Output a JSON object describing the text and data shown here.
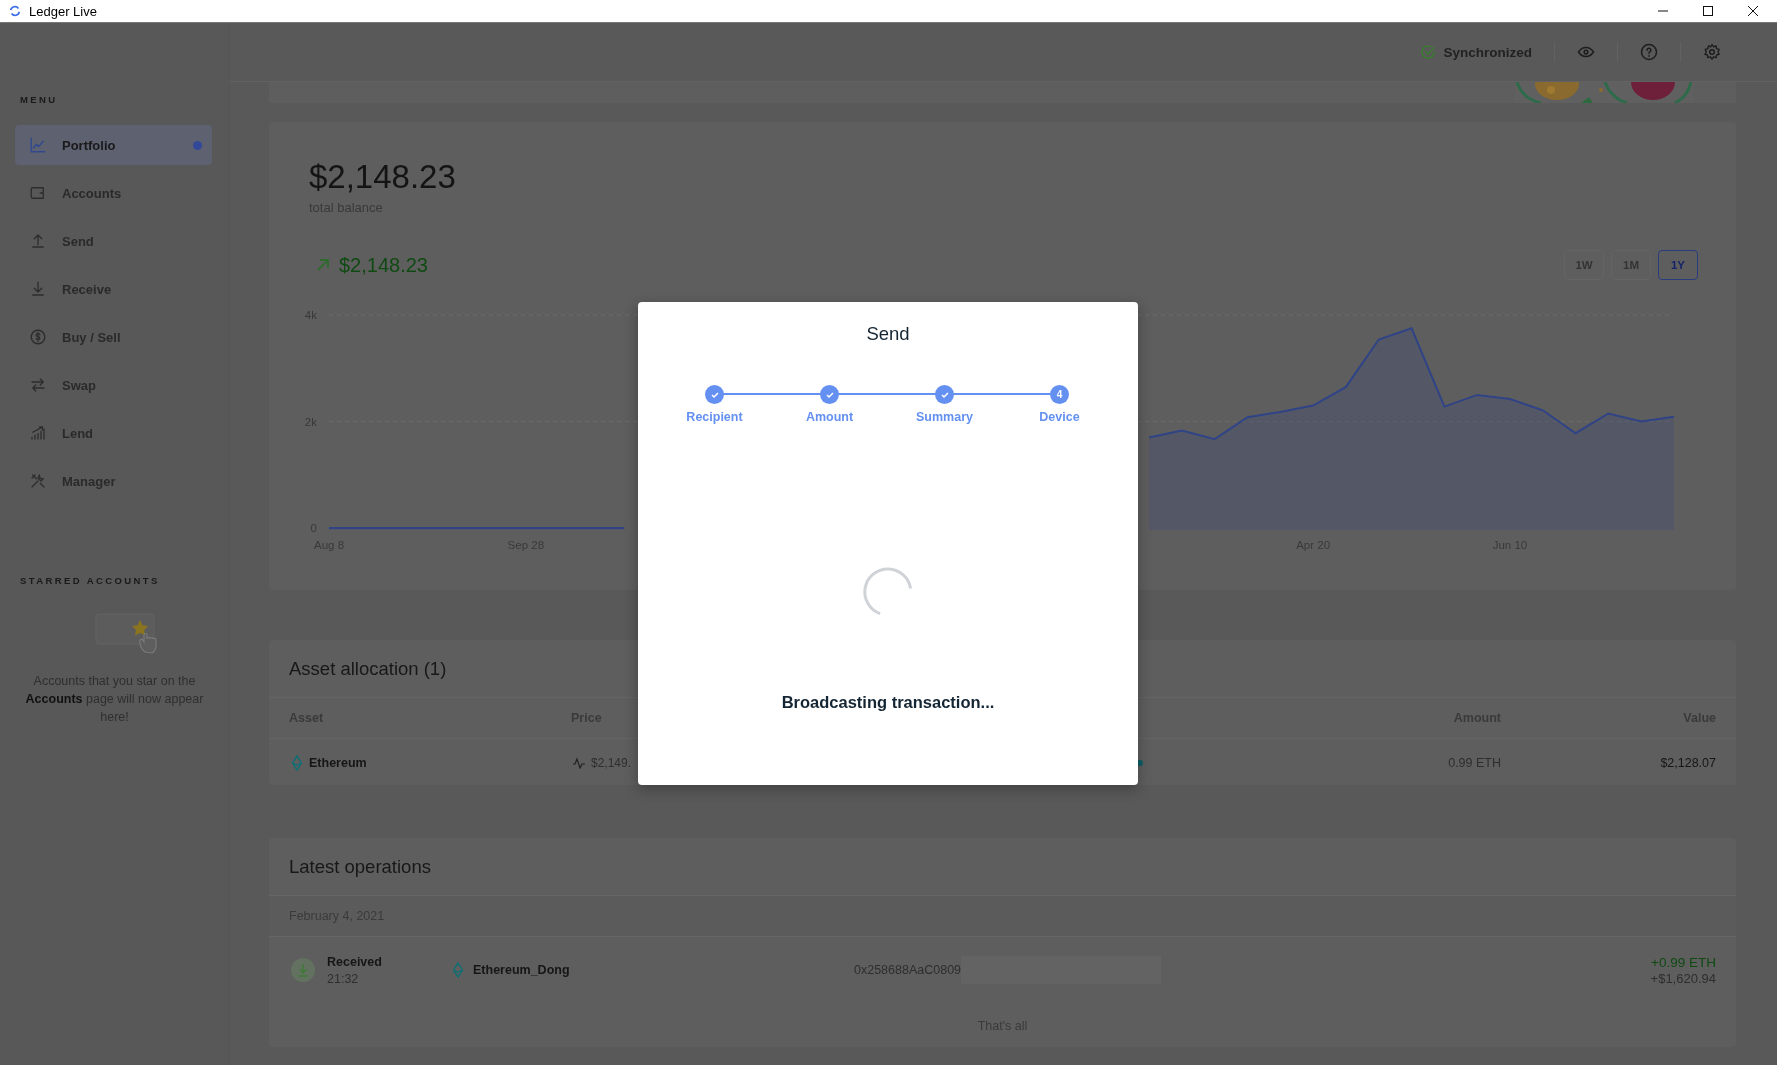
{
  "window": {
    "title": "Ledger Live"
  },
  "sidebar": {
    "menu_label": "MENU",
    "items": [
      {
        "label": "Portfolio",
        "selected": true,
        "badge": true
      },
      {
        "label": "Accounts",
        "selected": false,
        "badge": false
      },
      {
        "label": "Send",
        "selected": false,
        "badge": false
      },
      {
        "label": "Receive",
        "selected": false,
        "badge": false
      },
      {
        "label": "Buy / Sell",
        "selected": false,
        "badge": false
      },
      {
        "label": "Swap",
        "selected": false,
        "badge": false
      },
      {
        "label": "Lend",
        "selected": false,
        "badge": false
      },
      {
        "label": "Manager",
        "selected": false,
        "badge": false
      }
    ],
    "starred_label": "STARRED ACCOUNTS",
    "starred_hint": "Accounts that you star on the **Accounts** page will now appear here!"
  },
  "top_bar": {
    "sync_status": "Synchronized"
  },
  "balance": {
    "amount": "$2,148.23",
    "caption": "total balance",
    "change": "$2,148.23",
    "periods": [
      {
        "label": "1W",
        "selected": false
      },
      {
        "label": "1M",
        "selected": false
      },
      {
        "label": "1Y",
        "selected": true
      }
    ],
    "chart_data": {
      "type": "area",
      "ylim": [
        0,
        4000
      ],
      "categories": [
        "Aug 8",
        null,
        null,
        null,
        null,
        null,
        "Sep 28",
        null,
        null,
        null,
        null,
        null,
        null,
        null,
        null,
        null,
        null,
        null,
        null,
        null,
        null,
        null,
        null,
        null,
        null,
        null,
        null,
        null,
        null,
        null,
        "Apr 20",
        null,
        null,
        null,
        null,
        null,
        "Jun 10",
        null,
        null,
        null,
        null,
        null
      ],
      "series": [
        {
          "color": "#2f4386",
          "values": [
            0,
            0,
            0,
            0,
            0,
            0,
            0,
            0,
            0,
            0,
            null,
            null,
            null,
            null,
            null,
            null,
            null,
            null,
            null,
            null,
            null,
            null,
            null,
            null,
            null,
            1700,
            1830,
            1670,
            2080,
            2180,
            2300,
            2650,
            3540,
            3750,
            2280,
            2500,
            2420,
            2210,
            1780,
            2150,
            2000,
            2090
          ]
        }
      ],
      "yticks": [
        {
          "value": 0,
          "label": "0"
        },
        {
          "value": 2000,
          "label": "2k"
        },
        {
          "value": 4000,
          "label": "4k"
        }
      ]
    }
  },
  "asset_allocation": {
    "title": "Asset allocation (1)",
    "columns": [
      "Asset",
      "Price",
      "Amount",
      "Value"
    ],
    "rows": [
      {
        "asset": "Ethereum",
        "price": "$2,149.",
        "amount": "0.99 ETH",
        "value": "$2,128.07"
      }
    ]
  },
  "latest_operations": {
    "title": "Latest operations",
    "date": "February 4, 2021",
    "operations": [
      {
        "type": "Received",
        "time": "21:32",
        "account": "Ethereum_Dong",
        "address": "0x258688AaC0809",
        "amount": "+0.99 ETH",
        "fiat": "+$1,620.94"
      }
    ],
    "footer": "That's all"
  },
  "modal": {
    "title": "Send",
    "steps": [
      {
        "label": "Recipient",
        "completed": true
      },
      {
        "label": "Amount",
        "completed": true
      },
      {
        "label": "Summary",
        "completed": true
      },
      {
        "label": "Device",
        "completed": false,
        "number": "4"
      }
    ],
    "status": "Broadcasting transaction..."
  }
}
